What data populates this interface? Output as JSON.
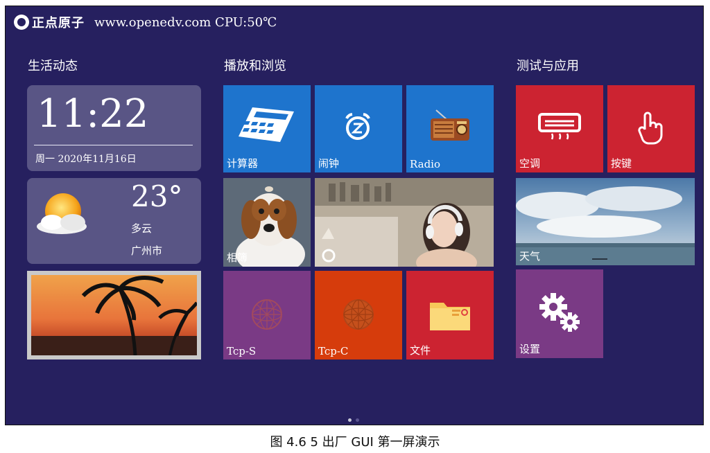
{
  "status_bar": {
    "logo_text": "正点原子",
    "site_cpu": "www.openedv.com CPU:50℃"
  },
  "sections": {
    "life": "生活动态",
    "media": "播放和浏览",
    "apps": "测试与应用"
  },
  "clock": {
    "time": "11:22",
    "date": "周一 2020年11月16日"
  },
  "weather": {
    "temperature": "23°",
    "condition": "多云",
    "city": "广州市"
  },
  "tiles": {
    "calculator": "计算器",
    "alarm": "闹钟",
    "radio": "Radio",
    "album": "相簿",
    "tcp_s": "Tcp-S",
    "tcp_c": "Tcp-C",
    "files": "文件",
    "aircon": "空调",
    "keys": "按键",
    "weather": "天气",
    "settings": "设置"
  },
  "colors": {
    "background": "#26205f",
    "blue_tile": "#1e74cd",
    "red_tile": "#cc2331",
    "purple_tile": "#7a3a85",
    "orange_tile": "#d63c0c"
  },
  "pager": {
    "pages": 2,
    "active": 1
  },
  "caption": "图 4.6 5 出厂 GUI 第一屏演示"
}
